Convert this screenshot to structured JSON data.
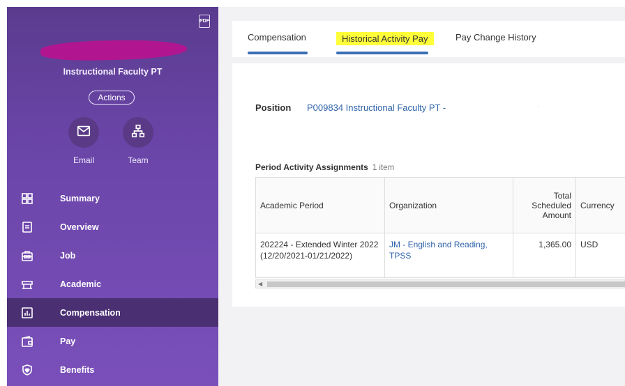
{
  "sidebar": {
    "pdf_label": "PDF",
    "role": "Instructional Faculty PT",
    "actions_label": "Actions",
    "quick_actions": [
      {
        "label": "Email",
        "icon": "envelope-icon"
      },
      {
        "label": "Team",
        "icon": "org-chart-icon"
      }
    ],
    "nav": [
      {
        "label": "Summary",
        "icon": "grid-icon"
      },
      {
        "label": "Overview",
        "icon": "document-icon"
      },
      {
        "label": "Job",
        "icon": "briefcase-icon"
      },
      {
        "label": "Academic",
        "icon": "academic-icon"
      },
      {
        "label": "Compensation",
        "icon": "chart-icon",
        "active": true
      },
      {
        "label": "Pay",
        "icon": "wallet-icon"
      },
      {
        "label": "Benefits",
        "icon": "shield-heart-icon"
      }
    ]
  },
  "tabs": [
    {
      "label": "Compensation"
    },
    {
      "label": "Historical Activity Pay",
      "highlighted": true
    },
    {
      "label": "Pay Change History"
    }
  ],
  "position": {
    "label": "Position",
    "value": "P009834 Instructional Faculty PT -",
    "faint": "·"
  },
  "assignments": {
    "title": "Period Activity Assignments",
    "count": "1 item",
    "headers": [
      "Academic Period",
      "Organization",
      "Total Scheduled Amount",
      "Currency"
    ],
    "rows": [
      {
        "period": "202224 - Extended Winter 2022 (12/20/2021-01/21/2022)",
        "organization": "JM - English and Reading, TPSS",
        "amount": "1,365.00",
        "currency": "USD"
      }
    ]
  },
  "colors": {
    "sidebar_top": "#5a3c8e",
    "sidebar_bottom": "#7a4fba",
    "active_nav": "#4b2f73",
    "link": "#2f63aa",
    "tab_underline": "#3a6fb5",
    "highlight": "#ffff3a"
  }
}
